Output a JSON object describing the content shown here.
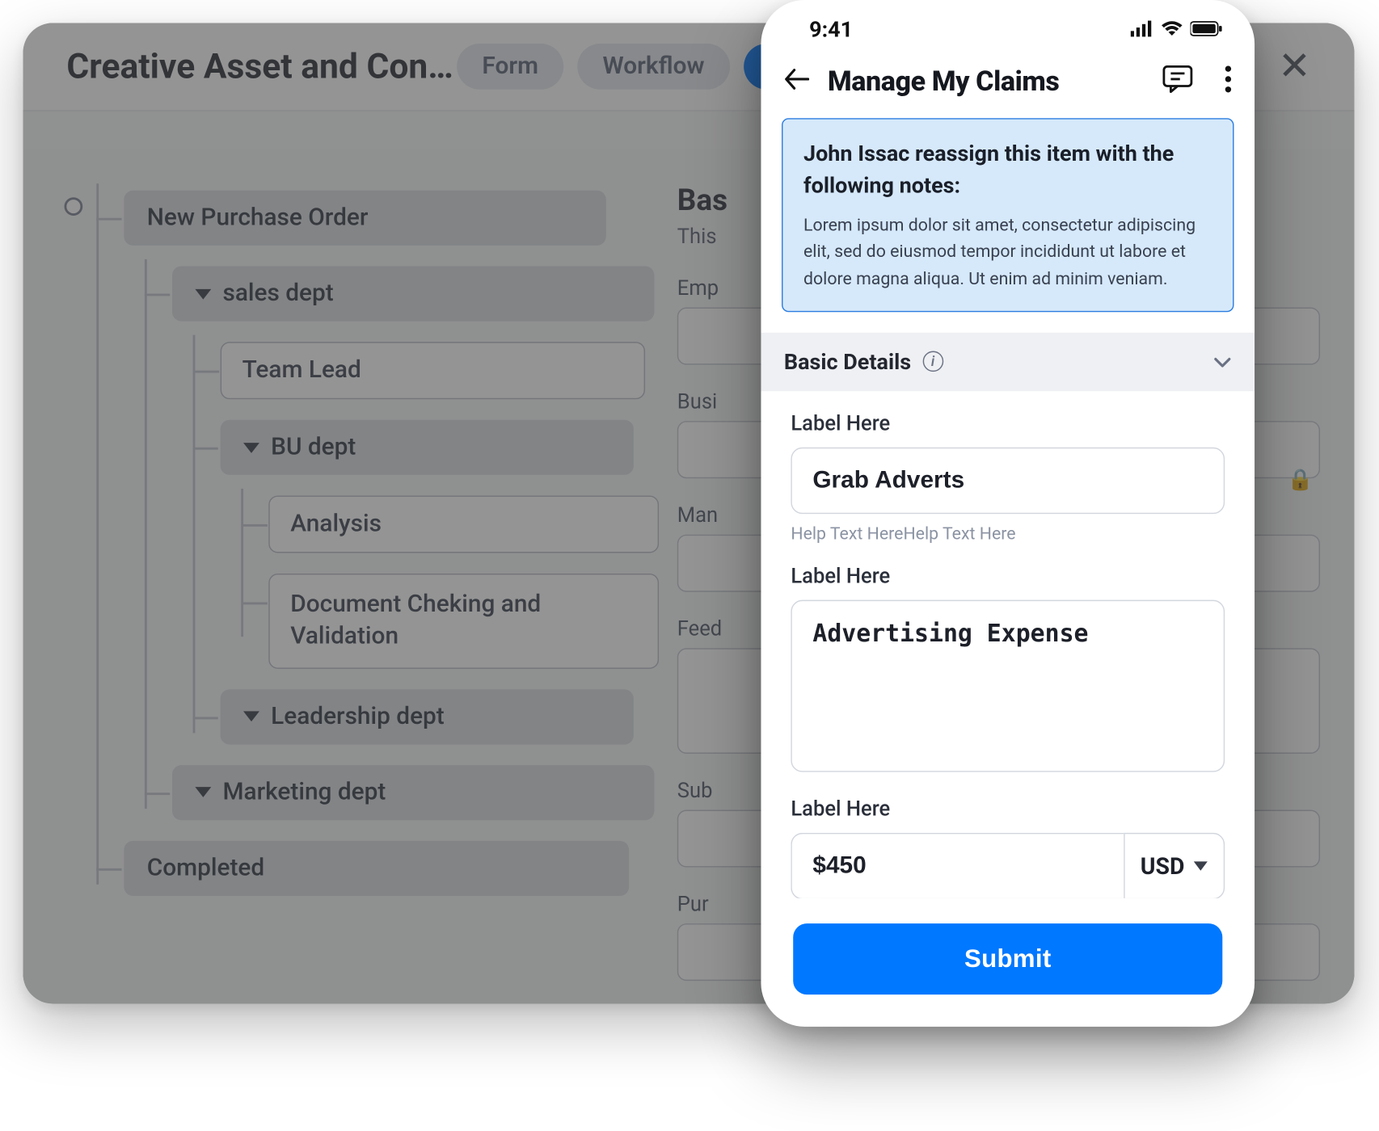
{
  "desktop": {
    "title": "Creative Asset and Conte...",
    "pills": {
      "form": "Form",
      "workflow": "Workflow"
    },
    "tree": {
      "root": "New Purchase Order",
      "sales": "sales dept",
      "teamLead": "Team Lead",
      "bu": "BU dept",
      "analysis": "Analysis",
      "docCheck": "Document Cheking and Validation",
      "leadership": "Leadership dept",
      "marketing": "Marketing dept",
      "completed": "Completed"
    },
    "form": {
      "heading": "Bas",
      "sub": "This",
      "labels": {
        "emp": "Emp",
        "busi": "Busi",
        "mana": "Man",
        "feed": "Feed",
        "subr": "Sub",
        "pur": "Pur"
      }
    }
  },
  "mobile": {
    "status": {
      "time": "9:41"
    },
    "header": {
      "title": "Manage My Claims"
    },
    "notice": {
      "title": "John Issac reassign this item with the following notes:",
      "body1": "Lorem ipsum dolor sit amet, consectetur adipiscing elit, sed do eiusmod tempor incididunt ut labore et",
      "body2": "dolore magna aliqua. Ut enim ad minim veniam."
    },
    "section": {
      "title": "Basic Details"
    },
    "field1": {
      "label": "Label Here",
      "value": "Grab Adverts",
      "help": "Help Text HereHelp Text Here"
    },
    "field2": {
      "label": "Label Here",
      "value": "Advertising Expense"
    },
    "field3": {
      "label": "Label Here",
      "amount": "$450",
      "currency": "USD"
    },
    "submit": "Submit"
  }
}
